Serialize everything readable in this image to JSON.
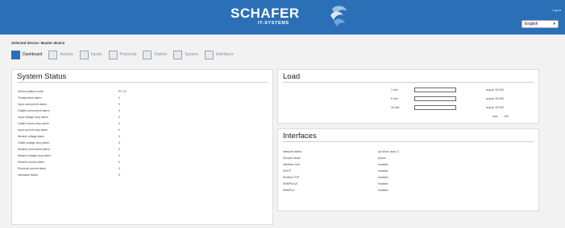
{
  "header": {
    "brand": "SCHAFER",
    "brand_sub": "IT-SYSTEMS",
    "top_small": "Logout",
    "language_selected": "English"
  },
  "page": {
    "subtitle": "Selected device: Master device"
  },
  "tabs": [
    {
      "label": "Dashboard",
      "active": true
    },
    {
      "label": "Actions",
      "active": false
    },
    {
      "label": "Inputs",
      "active": false
    },
    {
      "label": "Protocols",
      "active": false
    },
    {
      "label": "Outlets",
      "active": false
    },
    {
      "label": "System",
      "active": false
    },
    {
      "label": "Interfaces",
      "active": false
    }
  ],
  "system_status": {
    "title": "System Status",
    "rows": [
      {
        "key": "Service station code",
        "value": "PC 12"
      },
      {
        "key": "Temperature alarm",
        "value": "0"
      },
      {
        "key": "Input overcurrent alarm",
        "value": "0"
      },
      {
        "key": "Outlets overcurrent alarm",
        "value": "0"
      },
      {
        "key": "Input voltage drop alarm",
        "value": "0"
      },
      {
        "key": "Outlet current drop alarm",
        "value": "0"
      },
      {
        "key": "Input current drop alarm",
        "value": "0"
      },
      {
        "key": "Neutral voltage alarm",
        "value": "0"
      },
      {
        "key": "Outlet voltage drop alarm",
        "value": "0"
      },
      {
        "key": "Neutral overcurrent alarm",
        "value": "0"
      },
      {
        "key": "Neutral voltage drop alarm",
        "value": "0"
      },
      {
        "key": "Neutral current alarm",
        "value": "0"
      },
      {
        "key": "Residual current alarm",
        "value": "0"
      },
      {
        "key": "Hardware alarm",
        "value": "0"
      }
    ]
  },
  "load": {
    "title": "Load",
    "rows": [
      {
        "label": "1 min",
        "fraction": 0.0,
        "avg": "avg at: 00.000"
      },
      {
        "label": "5 min",
        "fraction": 0.0,
        "avg": "avg at: 00.000"
      },
      {
        "label": "15 min",
        "fraction": 0.0,
        "avg": "avg at: 00.000"
      }
    ],
    "foot_left": "max",
    "foot_right": "100"
  },
  "interfaces": {
    "title": "Interfaces",
    "rows": [
      {
        "key": "Network status",
        "value": "Up since (sec): 0"
      },
      {
        "key": "Service mode",
        "value": "Active"
      },
      {
        "key": "Interface Link",
        "value": "enabled"
      },
      {
        "key": "DHCP",
        "value": "enabled"
      },
      {
        "key": "Modbus TCP",
        "value": "enabled"
      },
      {
        "key": "SNMPv1/v2",
        "value": "enabled"
      },
      {
        "key": "SNMPv3",
        "value": "enabled"
      }
    ]
  },
  "colors": {
    "header_blue": "#2b70b6",
    "accent": "#4a88c8"
  }
}
